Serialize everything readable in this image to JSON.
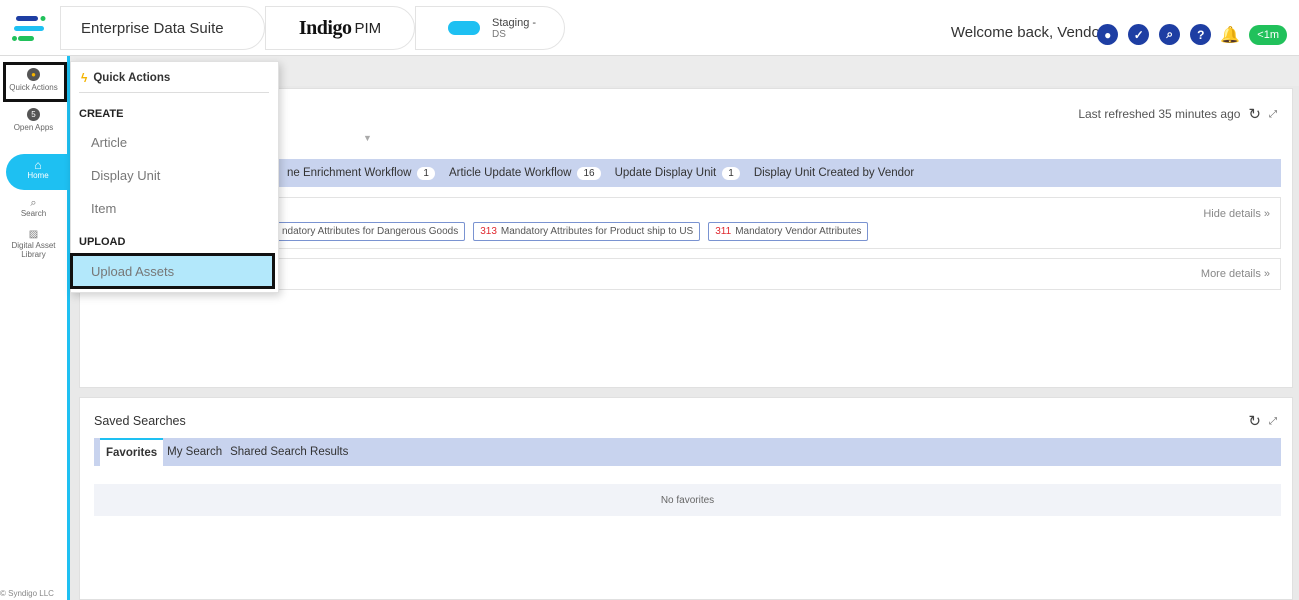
{
  "header": {
    "suite_title": "Enterprise Data Suite",
    "brand_bold": "Indigo",
    "brand_light": "PIM",
    "env_label": "Staging -",
    "env_sub": "DS",
    "welcome": "Welcome back, Vendor!",
    "time_badge": "<1m"
  },
  "sidebar": {
    "quick_actions": "Quick Actions",
    "open_apps": "Open Apps",
    "open_apps_count": "5",
    "home": "Home",
    "search": "Search",
    "dal_1": "Digital Asset",
    "dal_2": "Library",
    "copyright": "© Syndigo LLC"
  },
  "dashboard": {
    "last_refreshed": "Last refreshed 35 minutes ago",
    "workflows": [
      {
        "label": "ne Enrichment Workflow",
        "count": "1"
      },
      {
        "label": "Article Update Workflow",
        "count": "16"
      },
      {
        "label": "Update Display Unit",
        "count": "1"
      },
      {
        "label": "Display Unit Created by Vendor",
        "count": ""
      }
    ],
    "hide_details": "Hide details »",
    "more_details": "More details »",
    "chips": [
      {
        "num": "",
        "label": "ndatory Attributes for Dangerous Goods"
      },
      {
        "num": "313",
        "label": "Mandatory Attributes for Product ship to US"
      },
      {
        "num": "311",
        "label": "Mandatory Vendor Attributes"
      }
    ]
  },
  "saved_searches": {
    "title": "Saved Searches",
    "tabs": [
      "Favorites",
      "My Search",
      "Shared Search Results"
    ],
    "empty": "No favorites"
  },
  "quick_actions_menu": {
    "title": "Quick Actions",
    "create_label": "CREATE",
    "create_items": [
      "Article",
      "Display Unit",
      "Item"
    ],
    "upload_label": "UPLOAD",
    "upload_items": [
      "Upload Assets"
    ]
  }
}
